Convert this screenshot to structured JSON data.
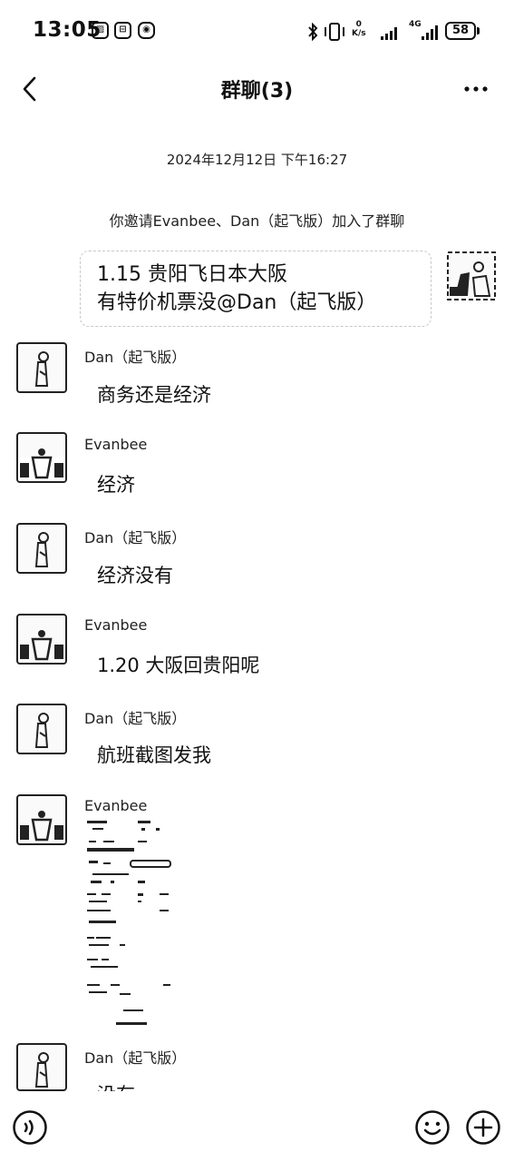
{
  "status_bar": {
    "time": "13:05",
    "speed_value": "0",
    "speed_unit": "K/s",
    "network": "4G",
    "battery": "58",
    "icons": [
      "gallery-icon",
      "bus-icon",
      "camera-icon",
      "bluetooth-icon",
      "vibrate-icon",
      "wifi-signal-icon",
      "cell-signal-icon"
    ]
  },
  "nav": {
    "title": "群聊(3)",
    "back_icon": "back-chevron-icon",
    "more_icon": "more-dots-icon"
  },
  "chat": {
    "timestamp": "2024年12月12日 下午16:27",
    "system_message": "你邀请Evanbee、Dan（起飞版）加入了群聊",
    "self_message": {
      "line1": "1.15 贵阳飞日本大阪",
      "line2": "有特价机票没@Dan（起飞版）"
    },
    "messages": [
      {
        "sender": "Dan（起飞版）",
        "text": "商务还是经济"
      },
      {
        "sender": "Evanbee",
        "text": "经济"
      },
      {
        "sender": "Dan（起飞版）",
        "text": "经济没有"
      },
      {
        "sender": "Evanbee",
        "text": "1.20 大阪回贵阳呢"
      },
      {
        "sender": "Dan（起飞版）",
        "text": "航班截图发我"
      },
      {
        "sender": "Evanbee",
        "text": ""
      },
      {
        "sender": "Dan（起飞版）",
        "text": "没有"
      }
    ]
  },
  "bottom_bar": {
    "voice_icon": "voice-icon",
    "emoji_icon": "emoji-icon",
    "add_icon": "plus-icon"
  },
  "colors": {
    "background": "#ffffff",
    "text": "#111111",
    "secondary_text": "#222222"
  }
}
